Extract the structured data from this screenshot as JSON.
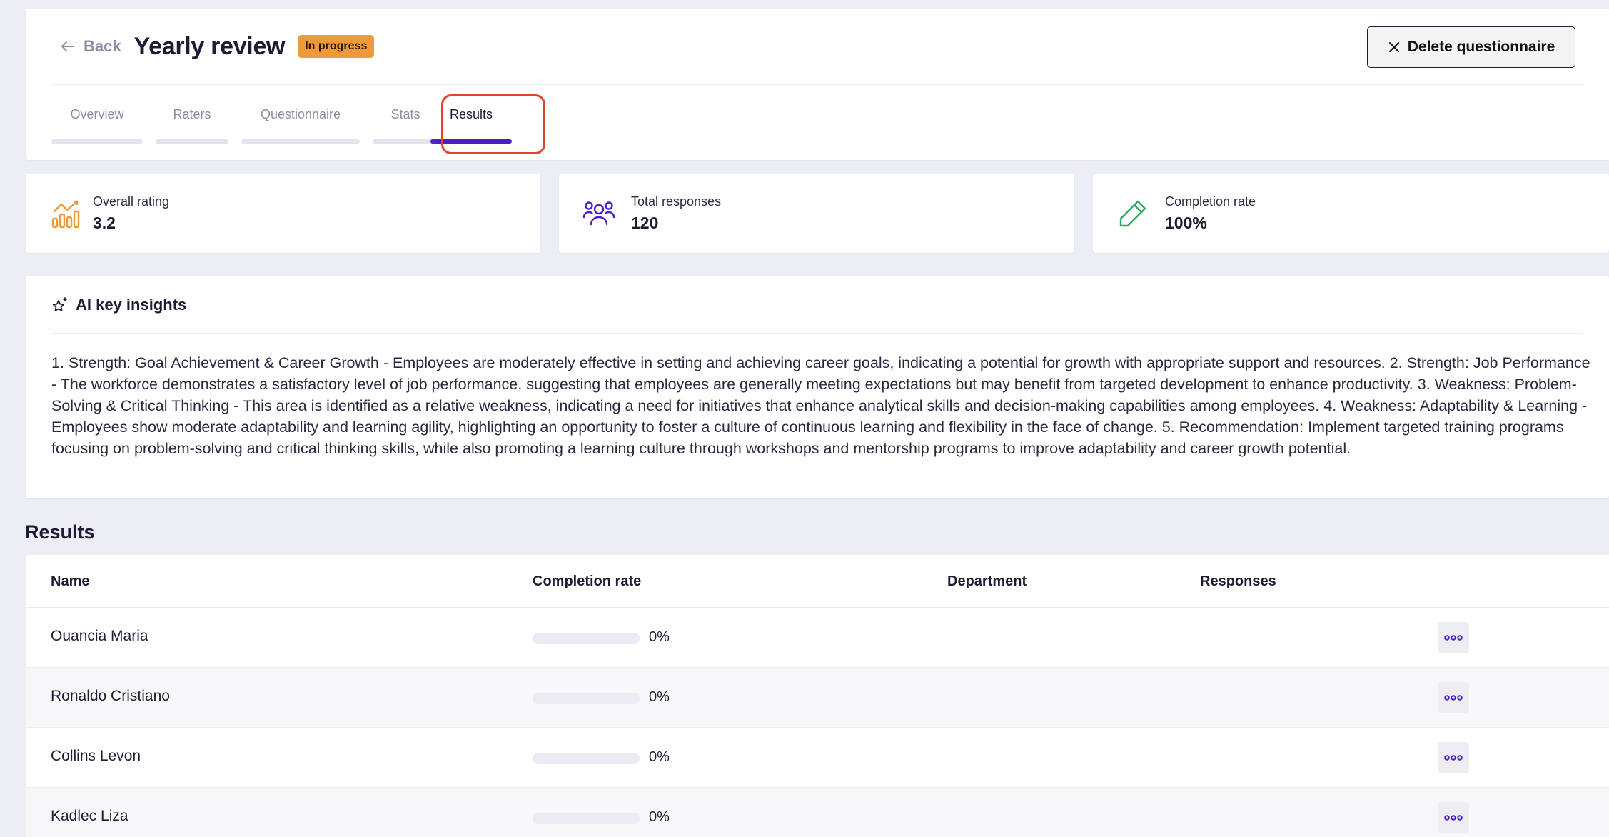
{
  "header": {
    "back_label": "Back",
    "title": "Yearly review",
    "status": "In progress",
    "delete_label": "Delete questionnaire"
  },
  "tabs": [
    {
      "label": "Overview",
      "active": false
    },
    {
      "label": "Raters",
      "active": false
    },
    {
      "label": "Questionnaire",
      "active": false
    },
    {
      "label": "Stats",
      "active": false
    },
    {
      "label": "Results",
      "active": true
    }
  ],
  "stats": [
    {
      "icon": "bar-chart-icon",
      "label": "Overall rating",
      "value": "3.2",
      "color": "#ee9a3a"
    },
    {
      "icon": "users-icon",
      "label": "Total responses",
      "value": "120",
      "color": "#4c1fc1"
    },
    {
      "icon": "pencil-icon",
      "label": "Completion rate",
      "value": "100%",
      "color": "#2ea866"
    }
  ],
  "insights": {
    "title": "AI key insights",
    "text": "1. Strength: Goal Achievement & Career Growth - Employees are moderately effective in setting and achieving career goals, indicating a potential for growth with appropriate support and resources. 2. Strength: Job Performance - The workforce demonstrates a satisfactory level of job performance, suggesting that employees are generally meeting expectations but may benefit from targeted development to enhance productivity. 3. Weakness: Problem-Solving & Critical Thinking - This area is identified as a relative weakness, indicating a need for initiatives that enhance analytical skills and decision-making capabilities among employees. 4. Weakness: Adaptability & Learning - Employees show moderate adaptability and learning agility, highlighting an opportunity to foster a culture of continuous learning and flexibility in the face of change. 5. Recommendation: Implement targeted training programs focusing on problem-solving and critical thinking skills, while also promoting a learning culture through workshops and mentorship programs to improve adaptability and career growth potential."
  },
  "results": {
    "heading": "Results",
    "columns": {
      "name": "Name",
      "completion": "Completion rate",
      "department": "Department",
      "responses": "Responses"
    },
    "rows": [
      {
        "name": "Ouancia Maria",
        "completion": 0,
        "completion_label": "0%",
        "department": "",
        "responses": ""
      },
      {
        "name": "Ronaldo Cristiano",
        "completion": 0,
        "completion_label": "0%",
        "department": "",
        "responses": ""
      },
      {
        "name": "Collins Levon",
        "completion": 0,
        "completion_label": "0%",
        "department": "",
        "responses": ""
      },
      {
        "name": "Kadlec Liza",
        "completion": 0,
        "completion_label": "0%",
        "department": "",
        "responses": ""
      }
    ]
  },
  "colors": {
    "accent": "#4c1fc1",
    "badge": "#ee9a3a",
    "highlight": "#e0452d"
  }
}
